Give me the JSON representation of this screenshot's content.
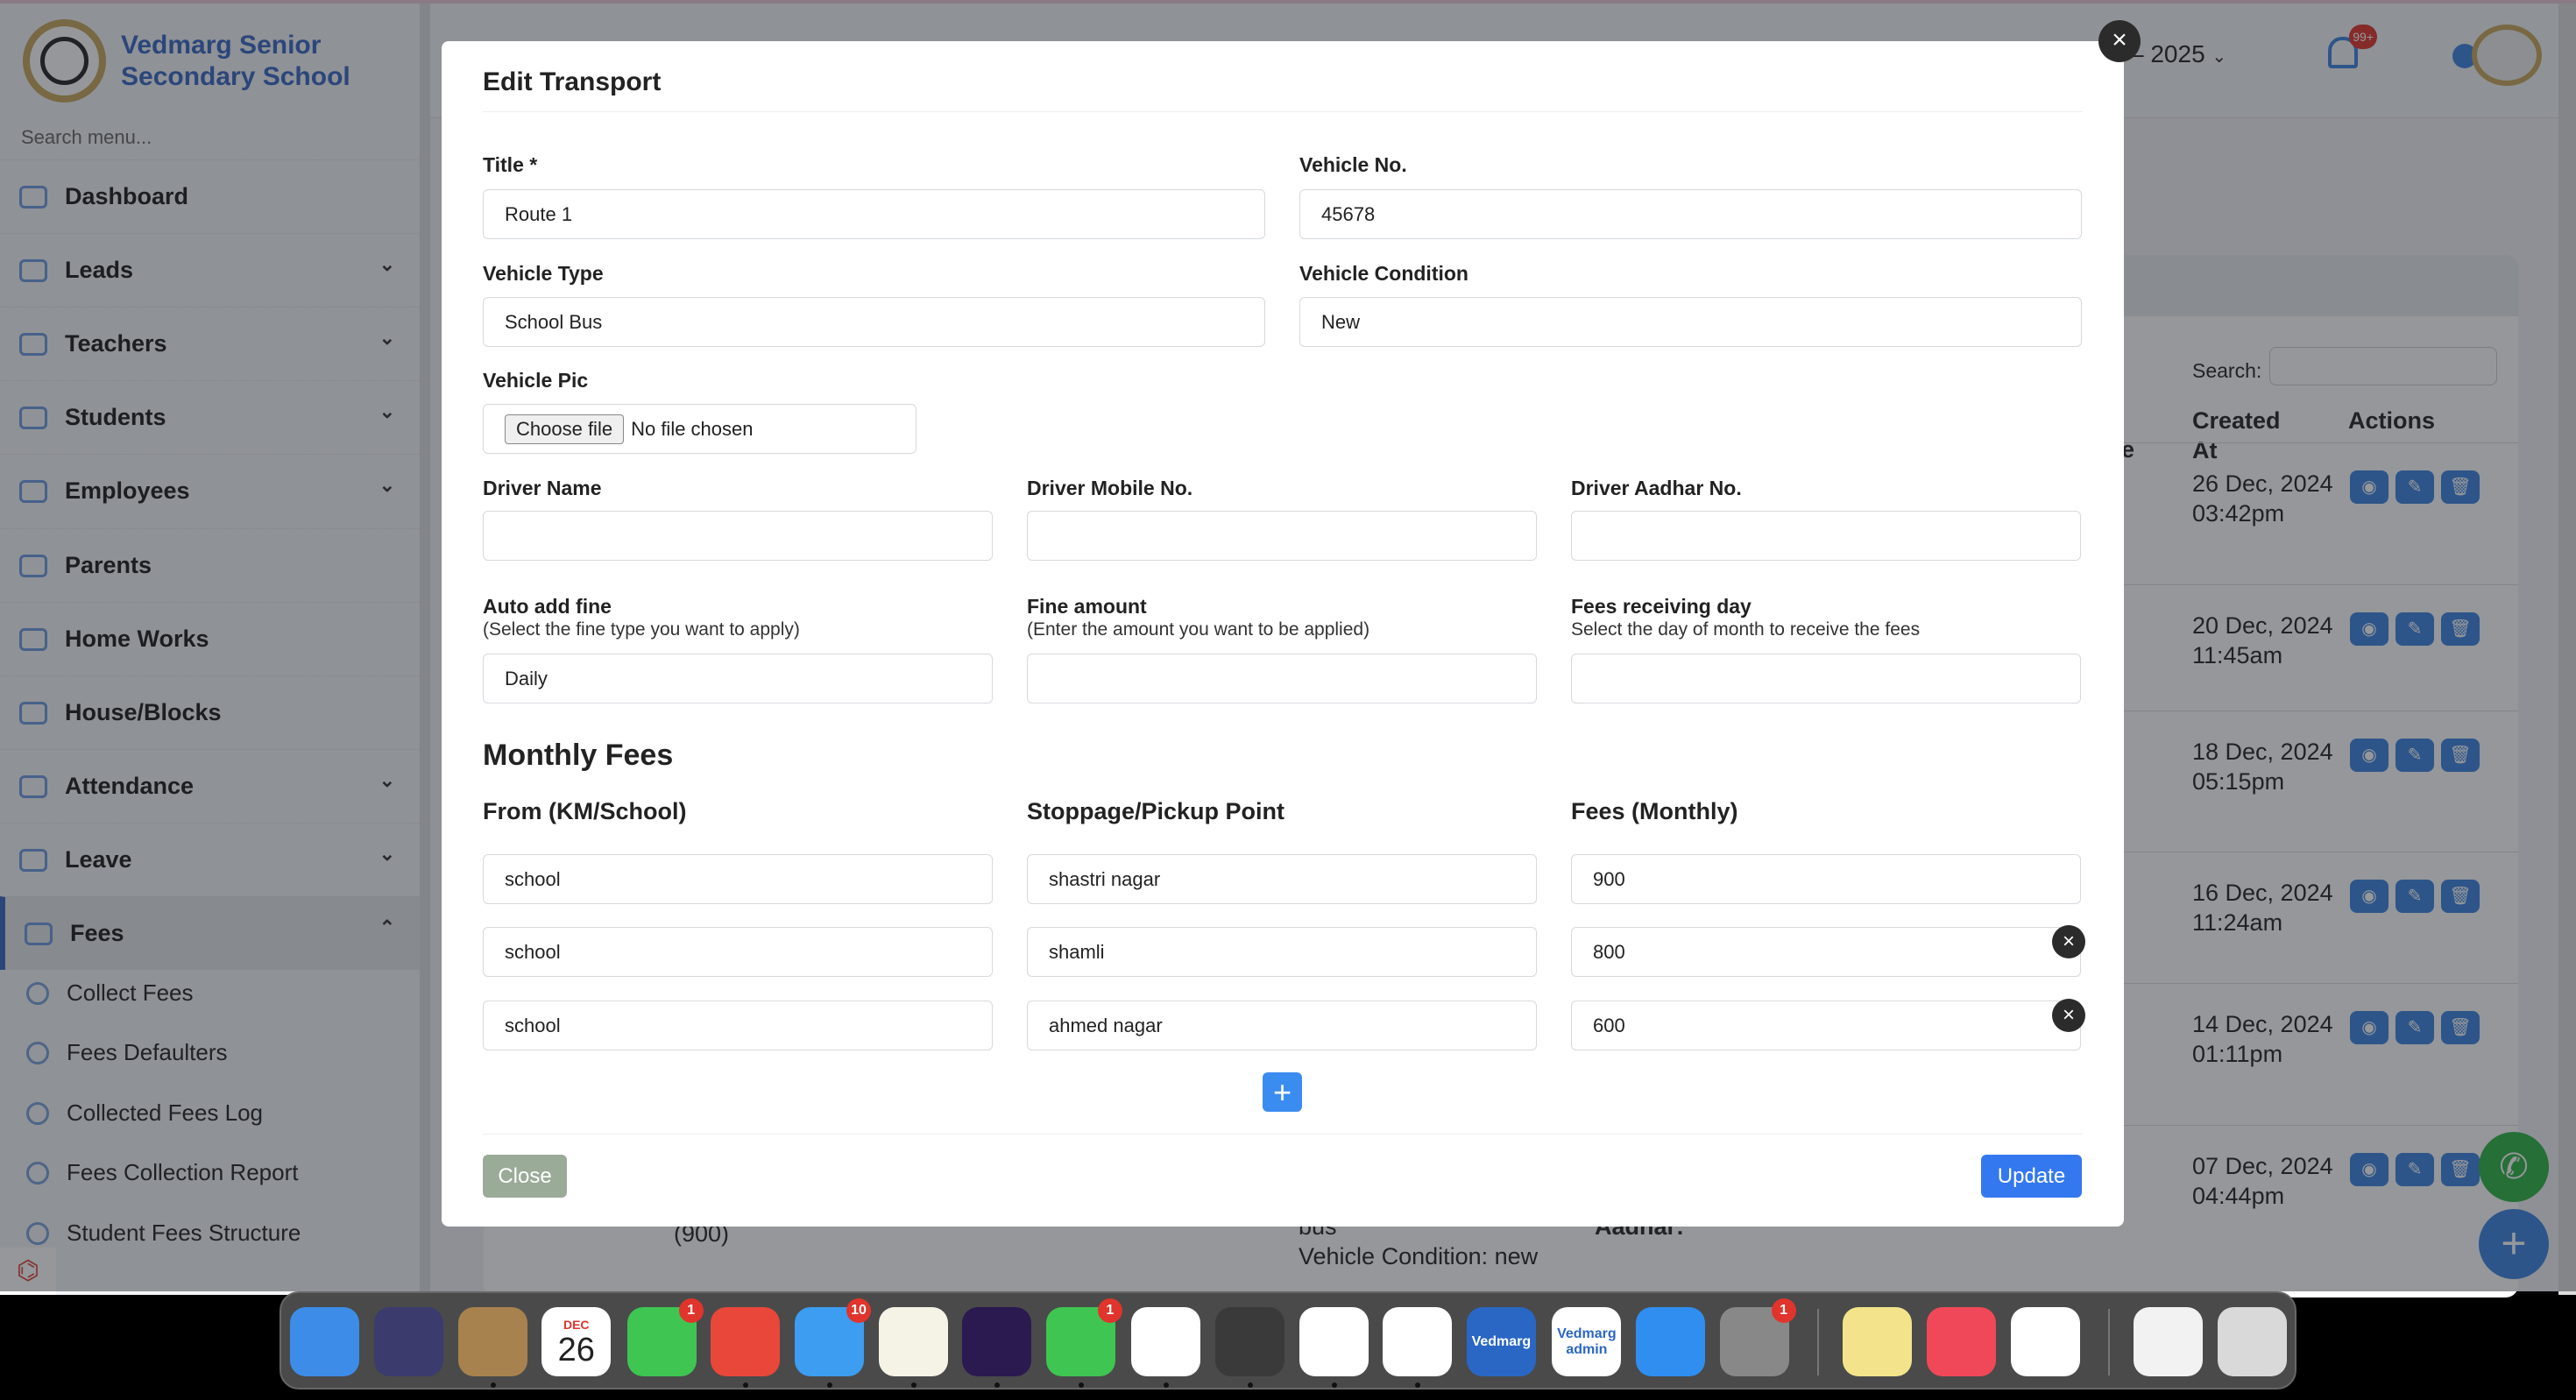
{
  "school": {
    "name_line1": "Vedmarg Senior",
    "name_line2": "Secondary School"
  },
  "sidebar": {
    "search_placeholder": "Search menu...",
    "items": [
      {
        "label": "Dashboard",
        "chevron": false
      },
      {
        "label": "Leads",
        "chevron": true
      },
      {
        "label": "Teachers",
        "chevron": true
      },
      {
        "label": "Students",
        "chevron": true
      },
      {
        "label": "Employees",
        "chevron": true
      },
      {
        "label": "Parents",
        "chevron": false
      },
      {
        "label": "Home Works",
        "chevron": false
      },
      {
        "label": "House/Blocks",
        "chevron": false
      },
      {
        "label": "Attendance",
        "chevron": true
      },
      {
        "label": "Leave",
        "chevron": true
      },
      {
        "label": "Fees",
        "chevron": true,
        "active": true
      }
    ],
    "fees_sub": [
      "Collect Fees",
      "Fees Defaulters",
      "Collected Fees Log",
      "Fees Collection Report",
      "Student Fees Structure"
    ]
  },
  "topbar": {
    "session": "– 2025",
    "notification_badge": "99+"
  },
  "table": {
    "search_label": "Search:",
    "headers": [
      "te",
      "Created At",
      "Actions"
    ],
    "created_at": [
      "26 Dec, 2024 03:42pm",
      "20 Dec, 2024 11:45am",
      "18 Dec, 2024 05:15pm",
      "16 Dec, 2024 11:24am",
      "14 Dec, 2024 01:11pm",
      "07 Dec, 2024 04:44pm"
    ],
    "bottom_fragments": {
      "fee": "(900)",
      "type": "bus",
      "condition": "Vehicle Condition: new",
      "aadhar": "Aadhar:"
    }
  },
  "modal": {
    "title": "Edit Transport",
    "fields": {
      "title": {
        "label": "Title *",
        "value": "Route 1"
      },
      "vehicle_no": {
        "label": "Vehicle No.",
        "value": "45678"
      },
      "vehicle_type": {
        "label": "Vehicle Type",
        "value": "School Bus"
      },
      "vehicle_condition": {
        "label": "Vehicle Condition",
        "value": "New"
      },
      "vehicle_pic": {
        "label": "Vehicle Pic",
        "button": "Choose file",
        "status": "No file chosen"
      },
      "driver_name": {
        "label": "Driver Name",
        "value": ""
      },
      "driver_mobile": {
        "label": "Driver Mobile No.",
        "value": ""
      },
      "driver_aadhar": {
        "label": "Driver Aadhar No.",
        "value": ""
      },
      "auto_add_fine": {
        "label": "Auto add fine",
        "hint": "(Select the fine type you want to apply)",
        "value": "Daily"
      },
      "fine_amount": {
        "label": "Fine amount",
        "hint": "(Enter the amount you want to be applied)",
        "value": ""
      },
      "fees_day": {
        "label": "Fees receiving day",
        "hint": "Select the day of month to receive the fees",
        "value": ""
      }
    },
    "monthly_fees": {
      "heading": "Monthly Fees",
      "headers": [
        "From (KM/School)",
        "Stoppage/Pickup Point",
        "Fees (Monthly)"
      ],
      "rows": [
        {
          "from": "school",
          "stop": "shastri nagar",
          "fees": "900"
        },
        {
          "from": "school",
          "stop": "shamli",
          "fees": "800"
        },
        {
          "from": "school",
          "stop": "ahmed nagar",
          "fees": "600"
        }
      ]
    },
    "close_label": "Close",
    "update_label": "Update"
  },
  "colors": {
    "primary": "#3478f0",
    "close_btn": "#9aab98",
    "brand": "#3a66c4"
  },
  "dock": {
    "calendar_month": "DEC",
    "calendar_day": "26",
    "apps": [
      {
        "name": "finder",
        "color": "#3d8de8"
      },
      {
        "name": "siri",
        "color": "#3b3b6e"
      },
      {
        "name": "contacts",
        "color": "#a8824e"
      },
      {
        "name": "calendar",
        "color": "#ffffff"
      },
      {
        "name": "facetime",
        "color": "#3fc552",
        "badge": "1"
      },
      {
        "name": "anydesk",
        "color": "#e8473a"
      },
      {
        "name": "mail",
        "color": "#3d9df0",
        "badge": "10"
      },
      {
        "name": "notes",
        "color": "#f5f2e6"
      },
      {
        "name": "firefox",
        "color": "#2a1a50"
      },
      {
        "name": "whatsapp",
        "color": "#3fc552",
        "badge": "1"
      },
      {
        "name": "chrome",
        "color": "#ffffff"
      },
      {
        "name": "sublime",
        "color": "#3a3a3a"
      },
      {
        "name": "safari",
        "color": "#ffffff"
      },
      {
        "name": "opera",
        "color": "#ffffff"
      },
      {
        "name": "vedmarg",
        "color": "#2a67c4",
        "label": "Vedmarg"
      },
      {
        "name": "vedmarg-admin",
        "color": "#ffffff",
        "label": "Vedmarg admin"
      },
      {
        "name": "app-store",
        "color": "#2f8ef0"
      },
      {
        "name": "system-settings",
        "color": "#888888",
        "badge": "1"
      },
      {
        "name": "stickies",
        "color": "#f3e48c"
      },
      {
        "name": "music",
        "color": "#f04858"
      },
      {
        "name": "excel",
        "color": "#ffffff"
      },
      {
        "name": "files",
        "color": "#f2f2f2"
      },
      {
        "name": "trash",
        "color": "#d9d9d9"
      }
    ]
  }
}
